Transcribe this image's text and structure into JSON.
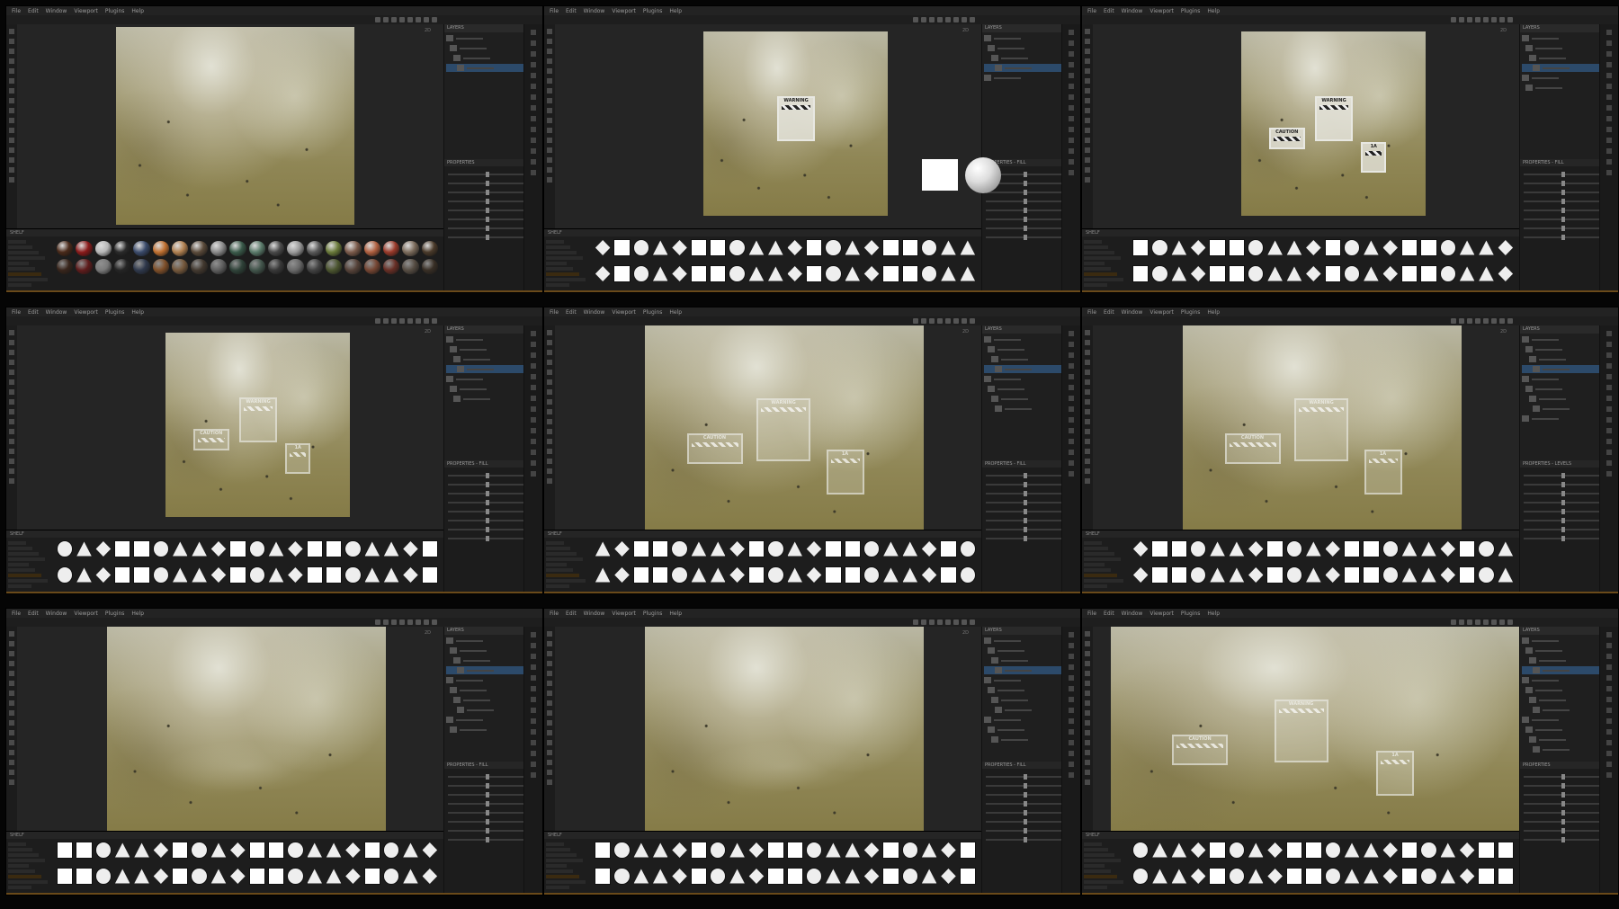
{
  "app": {
    "menu": [
      "File",
      "Edit",
      "Window",
      "Viewport",
      "Plugins",
      "Help"
    ]
  },
  "panels": [
    {
      "id": "p1",
      "layers_title": "LAYERS",
      "props_title": "PROPERTIES",
      "shelf_title": "SHELF",
      "stage": "materials",
      "signs": []
    },
    {
      "id": "p2",
      "layers_title": "LAYERS",
      "props_title": "PROPERTIES - FILL",
      "shelf_title": "SHELF",
      "stage": "decals",
      "signs": [
        "WARNING"
      ]
    },
    {
      "id": "p3",
      "layers_title": "LAYERS",
      "props_title": "PROPERTIES - FILL",
      "shelf_title": "SHELF",
      "stage": "decals",
      "signs": [
        "WARNING",
        "CAUTION",
        "1A"
      ]
    },
    {
      "id": "p4",
      "layers_title": "LAYERS",
      "props_title": "PROPERTIES - FILL",
      "shelf_title": "SHELF",
      "stage": "decals",
      "signs": [
        "WARNING",
        "CAUTION",
        "1A"
      ]
    },
    {
      "id": "p5",
      "layers_title": "LAYERS",
      "props_title": "PROPERTIES - FILL",
      "shelf_title": "SHELF",
      "stage": "decals",
      "signs": [
        "WARNING",
        "CAUTION",
        "1A"
      ]
    },
    {
      "id": "p6",
      "layers_title": "LAYERS",
      "props_title": "PROPERTIES - LEVELS",
      "shelf_title": "SHELF",
      "stage": "decals",
      "signs": [
        "WARNING",
        "CAUTION",
        "1A"
      ]
    },
    {
      "id": "p7",
      "layers_title": "LAYERS",
      "props_title": "PROPERTIES - FILL",
      "shelf_title": "SHELF",
      "stage": "faded",
      "signs": []
    },
    {
      "id": "p8",
      "layers_title": "LAYERS",
      "props_title": "PROPERTIES - FILL",
      "shelf_title": "SHELF",
      "stage": "faded",
      "signs": []
    },
    {
      "id": "p9",
      "layers_title": "LAYERS",
      "props_title": "PROPERTIES",
      "shelf_title": "SHELF",
      "stage": "decals",
      "signs": [
        "WARNING",
        "CAUTION",
        "1A"
      ]
    }
  ],
  "sign_text": {
    "warning": "WARNING",
    "caution": "CAUTION",
    "number": "1A"
  },
  "viewport_label": "2D",
  "colors": {
    "accent_selection": "#2c4a6a",
    "accent_category": "#d89a3a",
    "background": "#1a1a1a"
  }
}
